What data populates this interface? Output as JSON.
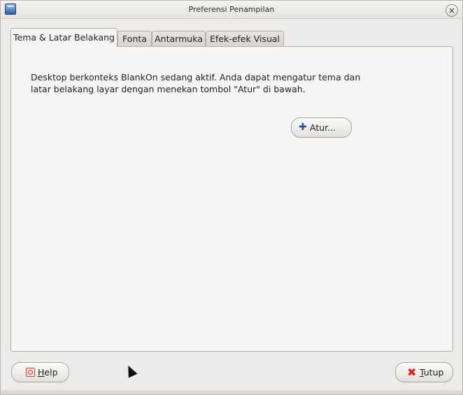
{
  "window": {
    "title": "Preferensi Penampilan"
  },
  "tabs": [
    {
      "label": "Tema & Latar Belakang",
      "active": true
    },
    {
      "label": "Fonta",
      "active": false
    },
    {
      "label": "Antarmuka",
      "active": false
    },
    {
      "label": "Efek-efek Visual",
      "active": false
    }
  ],
  "content": {
    "description_line1": "Desktop berkonteks BlankOn sedang aktif. Anda dapat mengatur tema dan",
    "description_line2": "latar belakang layar dengan menekan tombol \"Atur\" di bawah.",
    "configure_button_label": "Atur..."
  },
  "footer": {
    "help_label_mnemonic": "H",
    "help_label_rest": "elp",
    "close_label_mnemonic": "T",
    "close_label_rest": "utup"
  },
  "icons": {
    "app": "preferences-icon",
    "close": "close-icon",
    "configure": "plus-icon",
    "help": "help-icon",
    "close_button": "x-icon"
  },
  "colors": {
    "accent_blue": "#2a4fa0",
    "close_red": "#d8231f"
  }
}
